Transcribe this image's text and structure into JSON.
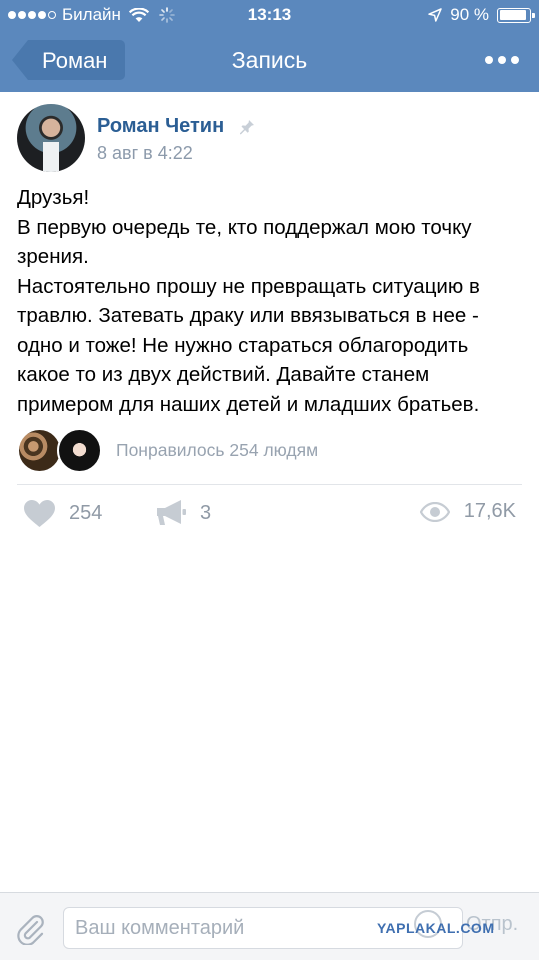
{
  "status_bar": {
    "carrier": "Билайн",
    "time": "13:13",
    "battery_percent": "90 %",
    "battery_level": 0.9,
    "signal_dots_filled": 4,
    "signal_dots_total": 5
  },
  "nav": {
    "back_label": "Роман",
    "title": "Запись",
    "more_icon": "more-dots-icon"
  },
  "post": {
    "author": "Роман Четин",
    "date": "8 авг в 4:22",
    "text_lines": [
      "Друзья!",
      "В первую очередь те, кто поддержал мою точку",
      "зрения.",
      "Настоятельно прошу не превращать ситуацию в",
      "травлю. Затевать драку или ввязываться в нее -",
      "одно и тоже! Не нужно стараться облагородить",
      "какое то из двух действий. Давайте станем",
      "примером для наших детей и младших братьев."
    ],
    "likes_summary": "Понравилось 254 людям",
    "likes_count": "254",
    "reposts_count": "3",
    "views_count": "17,6K"
  },
  "comment_bar": {
    "placeholder": "Ваш комментарий",
    "send_label": "Отпр.",
    "watermark": "YAPLAKAL.COM"
  },
  "colors": {
    "header_bg": "#5b88bd",
    "author_link": "#2b5e94",
    "muted": "#909aa6"
  }
}
